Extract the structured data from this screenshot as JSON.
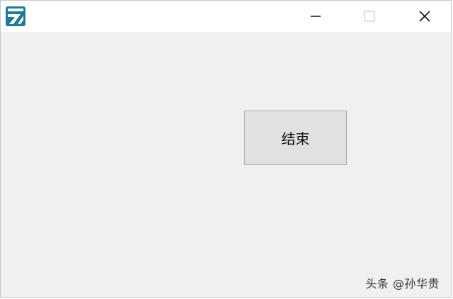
{
  "window": {
    "app_icon": "app-logo-icon",
    "controls": {
      "minimize_icon": "minimize-icon",
      "maximize_icon": "maximize-icon",
      "close_icon": "close-icon"
    }
  },
  "main": {
    "end_button_label": "结束"
  },
  "watermark": {
    "text": "头条 @孙华贵"
  },
  "colors": {
    "client_bg": "#f0f0f0",
    "titlebar_bg": "#ffffff",
    "button_bg": "#e1e1e1",
    "button_border": "#adadad",
    "icon_teal": "#1c7c9a"
  }
}
